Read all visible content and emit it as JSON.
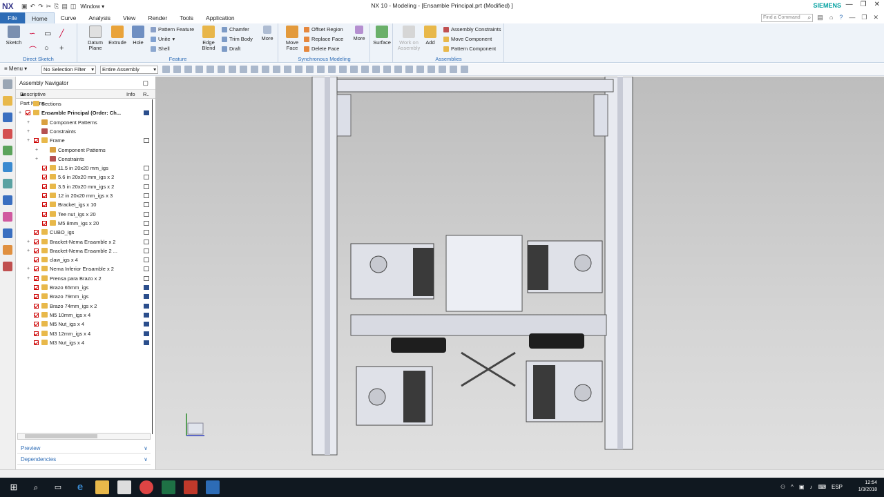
{
  "app": {
    "logo": "NX",
    "window_menu": "Window",
    "title": "NX 10 - Modeling - [Ensamble Principal.prt (Modified) ]",
    "brand": "SIEMENS",
    "window_controls": [
      "minimize-icon",
      "restore-icon",
      "close-icon"
    ]
  },
  "menu_tabs": [
    "File",
    "Home",
    "Curve",
    "Analysis",
    "View",
    "Render",
    "Tools",
    "Application"
  ],
  "active_tab": "Home",
  "command_search": {
    "placeholder": "Find a Command"
  },
  "ribbon": {
    "direct_sketch": {
      "label": "Direct Sketch",
      "sketch": "Sketch"
    },
    "feature": {
      "label": "Feature",
      "datum_plane": "Datum Plane",
      "extrude": "Extrude",
      "hole": "Hole",
      "pattern_feature": "Pattern Feature",
      "unite": "Unite",
      "shell": "Shell",
      "edge_blend": "Edge Blend",
      "chamfer": "Chamfer",
      "trim_body": "Trim Body",
      "draft": "Draft",
      "more": "More"
    },
    "synchronous": {
      "label": "Synchronous Modeling",
      "move_face": "Move Face",
      "offset_region": "Offset Region",
      "replace_face": "Replace Face",
      "delete_face": "Delete Face",
      "more": "More"
    },
    "surface": {
      "label": "Surface"
    },
    "assemblies": {
      "label": "Assemblies",
      "work_on_assembly": "Work on Assembly",
      "add": "Add",
      "assembly_constraints": "Assembly Constraints",
      "move_component": "Move Component",
      "pattern_component": "Pattern Component"
    }
  },
  "toolbar": {
    "menu": "Menu",
    "selection_filter": "No Selection Filter",
    "scope": "Entire Assembly"
  },
  "navigator": {
    "title": "Assembly Navigator",
    "col_name": "Descriptive Part Name",
    "col_info": "Info",
    "col_r": "R..",
    "rows": [
      {
        "label": "Sections",
        "level": 0,
        "kind": "folder"
      },
      {
        "label": "Ensamble Principal (Order: Ch...",
        "level": 0,
        "kind": "assembly",
        "bold": true,
        "save": true
      },
      {
        "label": "Component Patterns",
        "level": 1,
        "kind": "patterns"
      },
      {
        "label": "Constraints",
        "level": 1,
        "kind": "constraints"
      },
      {
        "label": "Frame",
        "level": 1,
        "kind": "assembly",
        "box": true
      },
      {
        "label": "Component Patterns",
        "level": 2,
        "kind": "patterns"
      },
      {
        "label": "Constraints",
        "level": 2,
        "kind": "constraints"
      },
      {
        "label": "11.5 in 20x20 mm_igs",
        "level": 2,
        "kind": "part",
        "box": true
      },
      {
        "label": "5.6 in 20x20 mm_igs x 2",
        "level": 2,
        "kind": "part",
        "box": true
      },
      {
        "label": "3.5 in 20x20 mm_igs x 2",
        "level": 2,
        "kind": "part",
        "box": true
      },
      {
        "label": "12 in 20x20 mm_igs x 3",
        "level": 2,
        "kind": "part",
        "box": true
      },
      {
        "label": "Bracket_igs x 10",
        "level": 2,
        "kind": "part",
        "box": true
      },
      {
        "label": "Tee nut_igs x 20",
        "level": 2,
        "kind": "part",
        "box": true
      },
      {
        "label": "M5 8mm_igs x 20",
        "level": 2,
        "kind": "part",
        "box": true
      },
      {
        "label": "CUBO_igs",
        "level": 1,
        "kind": "part",
        "box": true
      },
      {
        "label": "Bracket-Nema Ensamble x 2",
        "level": 1,
        "kind": "assembly",
        "box": true
      },
      {
        "label": "Bracket-Nema Ensamble 2 ...",
        "level": 1,
        "kind": "assembly",
        "box": true
      },
      {
        "label": "claw_igs x 4",
        "level": 1,
        "kind": "part",
        "box": true
      },
      {
        "label": "Nema Inferior Ensamble x 2",
        "level": 1,
        "kind": "assembly",
        "box": true
      },
      {
        "label": "Prensa para Brazo x 2",
        "level": 1,
        "kind": "assembly",
        "box": true
      },
      {
        "label": "Brazo 65mm_igs",
        "level": 1,
        "kind": "part",
        "save": true
      },
      {
        "label": "Brazo 79mm_igs",
        "level": 1,
        "kind": "part",
        "save": true
      },
      {
        "label": "Brazo 74mm_igs x 2",
        "level": 1,
        "kind": "part",
        "save": true
      },
      {
        "label": "M5 10mm_igs x 4",
        "level": 1,
        "kind": "part",
        "save": true
      },
      {
        "label": "M5 Nut_igs x 4",
        "level": 1,
        "kind": "part",
        "save": true
      },
      {
        "label": "M3 12mm_igs x 4",
        "level": 1,
        "kind": "part",
        "save": true
      },
      {
        "label": "M3 Nut_igs x 4",
        "level": 1,
        "kind": "part",
        "save": true
      }
    ],
    "panels": [
      "Preview",
      "Dependencies"
    ]
  },
  "taskbar": {
    "time": "12:54",
    "date": "1/3/2018",
    "lang": "ESP"
  }
}
